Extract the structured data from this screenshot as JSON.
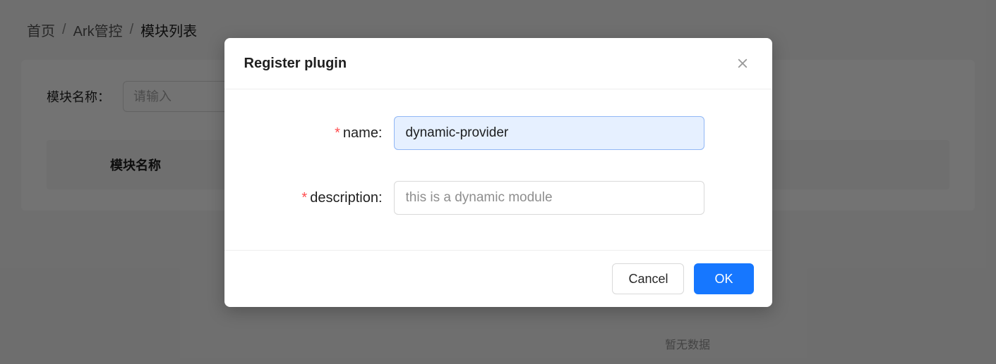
{
  "breadcrumb": {
    "home": "首页",
    "section": "Ark管控",
    "current": "模块列表"
  },
  "filter": {
    "label": "模块名称：",
    "placeholder": "请输入"
  },
  "table": {
    "header_module_name": "模块名称"
  },
  "empty_text": "暂无数据",
  "modal": {
    "title": "Register plugin",
    "fields": {
      "name_label": "name:",
      "name_value": "dynamic-provider",
      "description_label": "description:",
      "description_placeholder": "this is a dynamic module"
    },
    "buttons": {
      "cancel": "Cancel",
      "ok": "OK"
    }
  }
}
